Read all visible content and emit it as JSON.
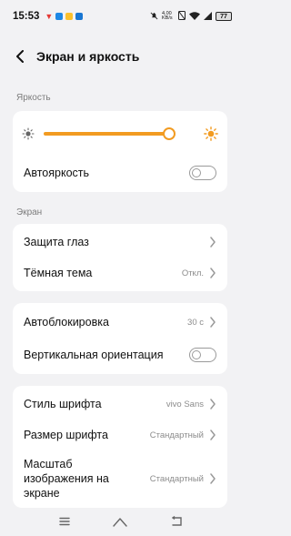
{
  "status_bar": {
    "time": "15:53",
    "network_speed": "4,00 KB/s",
    "battery": "77",
    "app_colors": [
      "#e53935",
      "#1e88e5",
      "#fbc02d",
      "#1976d2"
    ]
  },
  "header": {
    "title": "Экран и яркость"
  },
  "brightness": {
    "section_label": "Яркость",
    "level_fraction": 0.84,
    "accent": "#f29b21",
    "auto_label": "Автояркость",
    "auto_on": false
  },
  "screen": {
    "section_label": "Экран",
    "eye_protection_label": "Защита глаз",
    "dark_theme_label": "Тёмная тема",
    "dark_theme_value": "Откл."
  },
  "lock": {
    "autolock_label": "Автоблокировка",
    "autolock_value": "30 с",
    "vertical_orientation_label": "Вертикальная ориентация",
    "vertical_orientation_on": false
  },
  "font": {
    "style_label": "Стиль шрифта",
    "style_value": "vivo Sans",
    "size_label": "Размер шрифта",
    "size_value": "Стандартный",
    "scale_label": "Масштаб изображения на экране",
    "scale_value": "Стандартный"
  }
}
